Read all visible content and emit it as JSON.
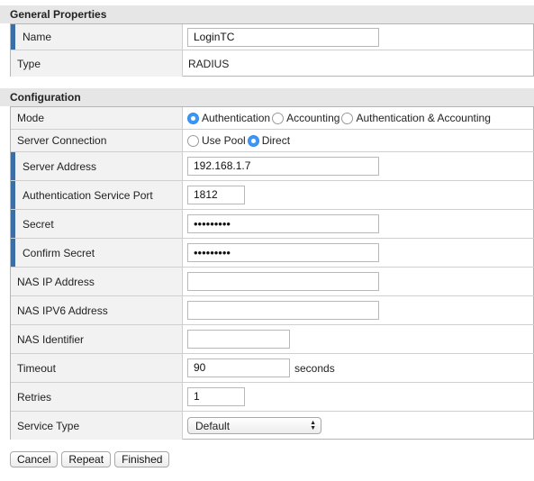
{
  "general": {
    "title": "General Properties",
    "name_label": "Name",
    "name_value": "LoginTC",
    "type_label": "Type",
    "type_value": "RADIUS"
  },
  "config": {
    "title": "Configuration",
    "mode_label": "Mode",
    "mode_options": [
      "Authentication",
      "Accounting",
      "Authentication & Accounting"
    ],
    "mode_selected": "Authentication",
    "server_conn_label": "Server Connection",
    "server_conn_options": [
      "Use Pool",
      "Direct"
    ],
    "server_conn_selected": "Direct",
    "server_address_label": "Server Address",
    "server_address_value": "192.168.1.7",
    "auth_port_label": "Authentication Service Port",
    "auth_port_value": "1812",
    "secret_label": "Secret",
    "secret_value": "•••••••••",
    "confirm_secret_label": "Confirm Secret",
    "confirm_secret_value": "•••••••••",
    "nas_ip_label": "NAS IP Address",
    "nas_ip_value": "",
    "nas_ipv6_label": "NAS IPV6 Address",
    "nas_ipv6_value": "",
    "nas_id_label": "NAS Identifier",
    "nas_id_value": "",
    "timeout_label": "Timeout",
    "timeout_value": "90",
    "timeout_unit": "seconds",
    "retries_label": "Retries",
    "retries_value": "1",
    "service_type_label": "Service Type",
    "service_type_value": "Default"
  },
  "buttons": {
    "cancel": "Cancel",
    "repeat": "Repeat",
    "finished": "Finished"
  },
  "colors": {
    "required_marker": "#3a6ea5",
    "radio_selected": "#3d95f5",
    "section_bg": "#e6e6e6",
    "label_bg": "#f2f2f2"
  }
}
